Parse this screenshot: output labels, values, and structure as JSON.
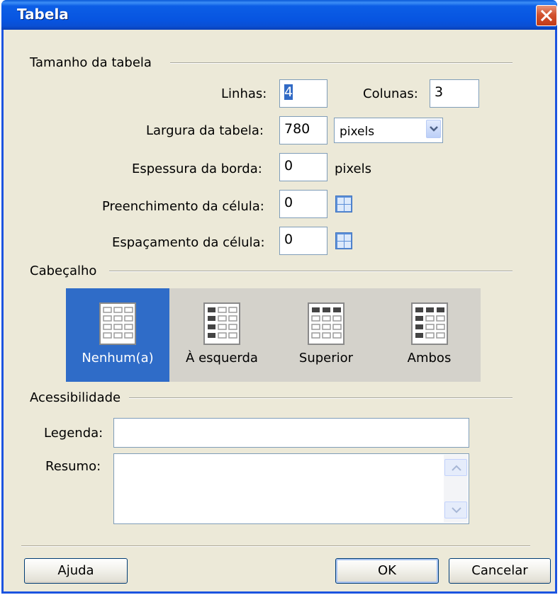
{
  "window": {
    "title": "Tabela"
  },
  "size_section": {
    "legend": "Tamanho da tabela",
    "rows_label": "Linhas:",
    "rows_value": "4",
    "cols_label": "Colunas:",
    "cols_value": "3",
    "width_label": "Largura da tabela:",
    "width_value": "780",
    "width_unit": "pixels",
    "border_label": "Espessura da borda:",
    "border_value": "0",
    "border_unit": "pixels",
    "padding_label": "Preenchimento da célula:",
    "padding_value": "0",
    "spacing_label": "Espaçamento da célula:",
    "spacing_value": "0"
  },
  "header_section": {
    "legend": "Cabeçalho",
    "options": [
      {
        "label": "Nenhum(a)",
        "selected": true
      },
      {
        "label": "À esquerda",
        "selected": false
      },
      {
        "label": "Superior",
        "selected": false
      },
      {
        "label": "Ambos",
        "selected": false
      }
    ]
  },
  "accessibility_section": {
    "legend": "Acessibilidade",
    "caption_label": "Legenda:",
    "caption_value": "",
    "summary_label": "Resumo:",
    "summary_value": ""
  },
  "buttons": {
    "help": "Ajuda",
    "ok": "OK",
    "cancel": "Cancelar"
  },
  "colors": {
    "titlebar": "#0754e0",
    "dialog_bg": "#ece9d8",
    "selected_header": "#2f6cc8",
    "header_panel": "#d4d2cb",
    "close": "#d2532f"
  }
}
